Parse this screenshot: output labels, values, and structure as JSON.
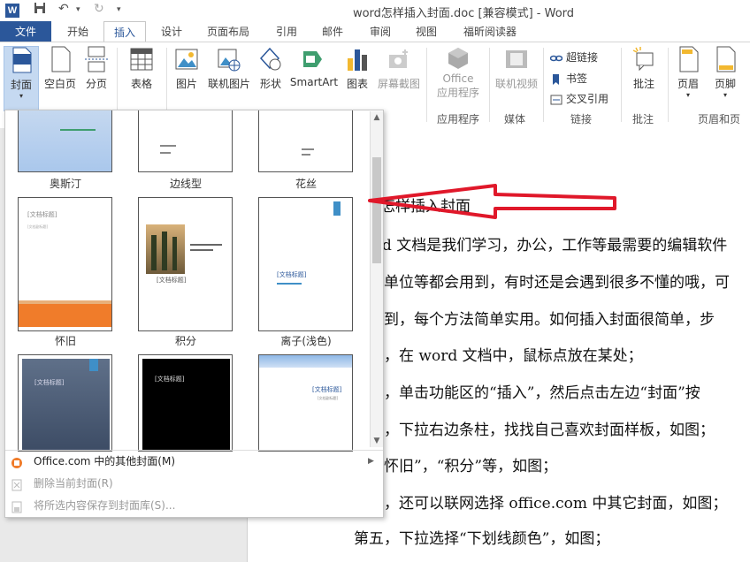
{
  "window": {
    "title": "word怎样插入封面.doc [兼容模式] - Word",
    "app_icon_letter": "W"
  },
  "tabs": [
    {
      "label": "文件"
    },
    {
      "label": "开始"
    },
    {
      "label": "插入"
    },
    {
      "label": "设计"
    },
    {
      "label": "页面布局"
    },
    {
      "label": "引用"
    },
    {
      "label": "邮件"
    },
    {
      "label": "审阅"
    },
    {
      "label": "视图"
    },
    {
      "label": "福昕阅读器"
    }
  ],
  "ribbon": {
    "cover": "封面",
    "blank_page": "空白页",
    "page_break": "分页",
    "table": "表格",
    "picture": "图片",
    "online_picture": "联机图片",
    "shapes": "形状",
    "smartart": "SmartArt",
    "chart": "图表",
    "screenshot": "屏幕截图",
    "office_apps_line1": "Office",
    "office_apps_line2": "应用程序",
    "group_apps": "应用程序",
    "online_video": "联机视频",
    "group_media": "媒体",
    "hyperlink": "超链接",
    "bookmark": "书签",
    "cross_ref": "交叉引用",
    "group_links": "链接",
    "comment": "批注",
    "group_comment": "批注",
    "header": "页眉",
    "footer": "页脚",
    "group_header_footer": "页眉和页脚"
  },
  "gallery": {
    "row1": [
      "奥斯汀",
      "边线型",
      "花丝"
    ],
    "row2": [
      "怀旧",
      "积分",
      "离子(浅色)"
    ],
    "thumb_text": {
      "doc_title": "[文档标题]",
      "doc_subtitle": "[文档副标题]"
    },
    "menu": {
      "more_covers": "Office.com 中的其他封面(M)",
      "remove_cover": "删除当前封面(R)",
      "save_selection": "将所选内容保存到封面库(S)..."
    }
  },
  "document": {
    "lines": [
      "怎样插入封面",
      "d  文档是我们学习，办公，工作等最需要的编辑软件",
      "单位等都会用到，有时还是会遇到很多不懂的哦，可",
      "到，每个方法简单实用。如何插入封面很简单，步",
      "，在 word 文档中，鼠标点放在某处；",
      "，单击功能区的“插入”，然后点击左边“封面”按",
      "，下拉右边条柱，找找自己喜欢封面样板，如图；",
      "怀旧”，“积分”等，如图；",
      "，还可以联网选择 office.com 中其它封面，如图；",
      "第五，下拉选择“下划线颜色”，如图；"
    ]
  },
  "colors": {
    "accent": "#2b579a",
    "arrow_red": "#e0182a",
    "vintage_orange": "#f07c2a"
  }
}
